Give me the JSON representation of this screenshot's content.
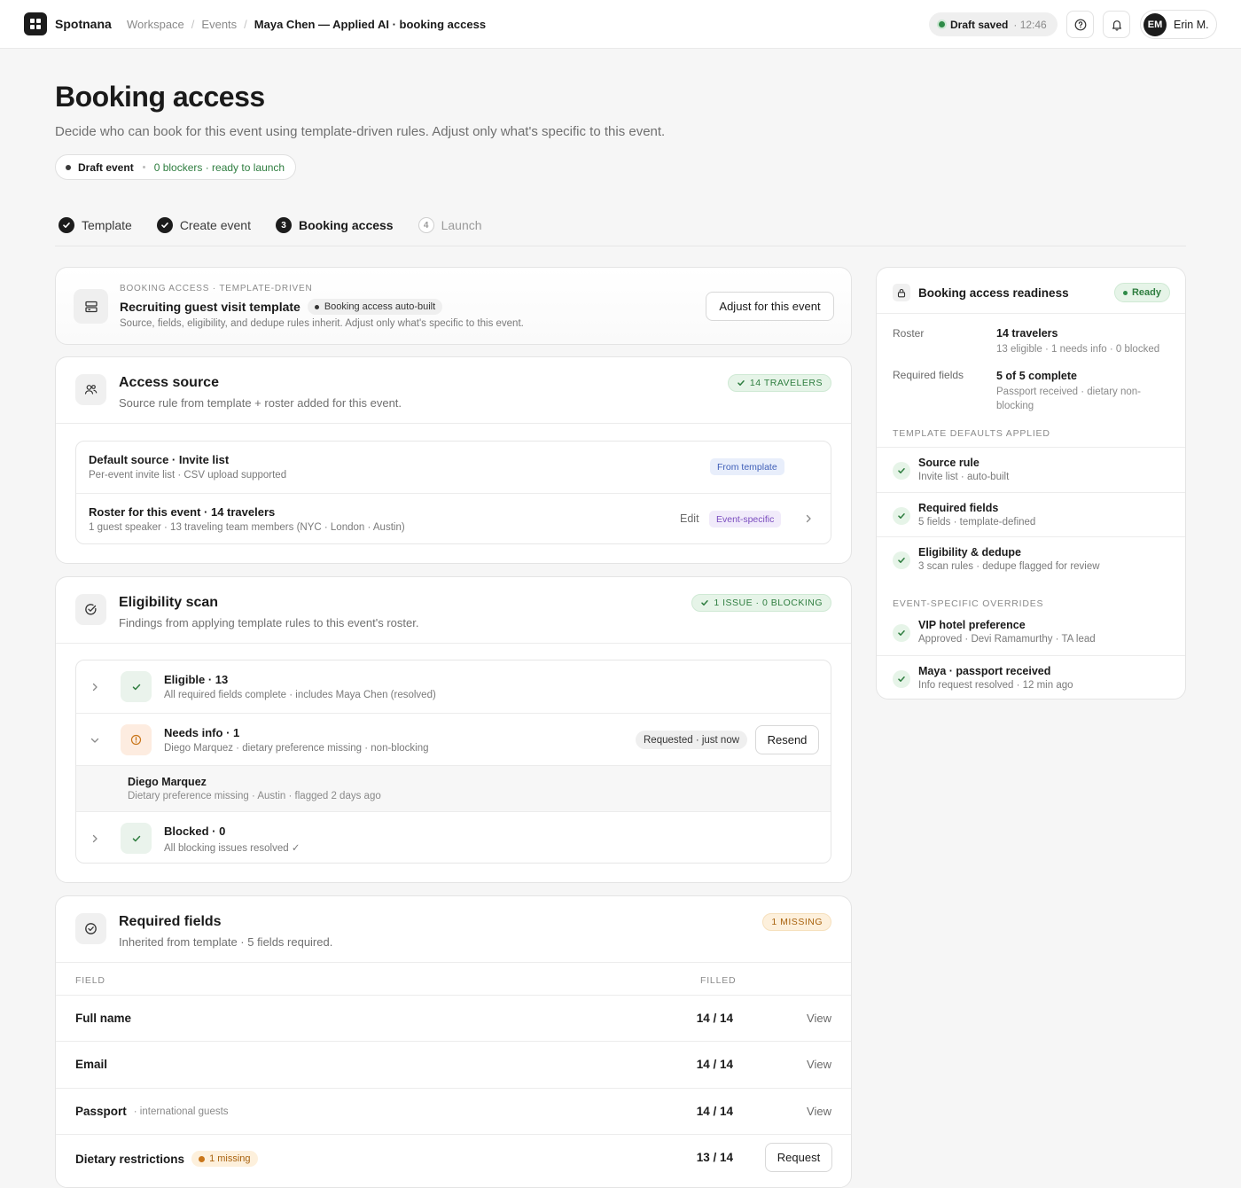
{
  "topbar": {
    "brand": "Spotnana",
    "crumbs": [
      "Workspace",
      "Events",
      "Maya Chen — Applied AI · booking access"
    ],
    "crumb_sep": "/",
    "saved_label": "Draft saved",
    "saved_time": "· 12:46",
    "user_initials": "EM",
    "user_name": "Erin M."
  },
  "page": {
    "title": "Booking access",
    "subtitle": "Decide who can book for this event using template-driven rules. Adjust only what's specific to this event.",
    "status_label": "Draft event",
    "status_note": "0 blockers · ready to launch"
  },
  "steps": [
    {
      "label": "Template",
      "state": "done"
    },
    {
      "label": "Create event",
      "state": "done"
    },
    {
      "label": "Booking access",
      "state": "current",
      "num": "3"
    },
    {
      "label": "Launch",
      "state": "todo",
      "num": "4"
    }
  ],
  "template_card": {
    "eyebrow": "BOOKING ACCESS · TEMPLATE-DRIVEN",
    "title": "Recruiting guest visit template",
    "chip": "Booking access auto-built",
    "desc": "Source, fields, eligibility, and dedupe rules inherit. Adjust only what's specific to this event.",
    "button": "Adjust for this event"
  },
  "access_source": {
    "title": "Access source",
    "subtitle": "Source rule from template + roster added for this event.",
    "badge": "14 TRAVELERS",
    "rows": [
      {
        "title": "Default source · Invite list",
        "sub": "Per-event invite list · CSV upload supported",
        "tag": "From template"
      },
      {
        "title": "Roster for this event · 14 travelers",
        "sub": "1 guest speaker · 13 traveling team members (NYC · London · Austin)",
        "edit": "Edit",
        "tag": "Event-specific"
      }
    ]
  },
  "eligibility": {
    "title": "Eligibility scan",
    "subtitle": "Findings from applying template rules to this event's roster.",
    "badge": "1 ISSUE · 0 BLOCKING",
    "rows": [
      {
        "title": "Eligible · 13",
        "sub": "All required fields complete · includes Maya Chen (resolved)"
      },
      {
        "title": "Needs info · 1",
        "sub": "Diego Marquez · dietary preference missing · non-blocking",
        "pill": "Requested · just now",
        "button": "Resend"
      },
      {
        "title": "Blocked · 0",
        "sub": "All blocking issues resolved ✓"
      }
    ],
    "detail": {
      "name": "Diego Marquez",
      "sub": "Dietary preference missing · Austin · flagged 2 days ago"
    }
  },
  "required_fields": {
    "title": "Required fields",
    "subtitle": "Inherited from template · 5 fields required.",
    "badge": "1 MISSING",
    "col_field": "FIELD",
    "col_filled": "FILLED",
    "rows": [
      {
        "name": "Full name",
        "note": "",
        "filled": "14 / 14",
        "action": "View"
      },
      {
        "name": "Email",
        "note": "",
        "filled": "14 / 14",
        "action": "View"
      },
      {
        "name": "Passport",
        "note": "· international guests",
        "filled": "14 / 14",
        "action": "View"
      },
      {
        "name": "Dietary restrictions",
        "missing": "1 missing",
        "filled": "13 / 14",
        "action": "Request"
      }
    ]
  },
  "readiness": {
    "title": "Booking access readiness",
    "status": "Ready",
    "roster_label": "Roster",
    "roster_value": "14 travelers",
    "roster_sub": "13 eligible · 1 needs info · 0 blocked",
    "fields_label": "Required fields",
    "fields_value": "5 of 5 complete",
    "fields_sub": "Passport received · dietary non-blocking",
    "defaults_heading": "TEMPLATE DEFAULTS APPLIED",
    "defaults": [
      {
        "title": "Source rule",
        "sub": "Invite list · auto-built"
      },
      {
        "title": "Required fields",
        "sub": "5 fields · template-defined"
      },
      {
        "title": "Eligibility & dedupe",
        "sub": "3 scan rules · dedupe flagged for review"
      }
    ],
    "overrides_heading": "EVENT-SPECIFIC OVERRIDES",
    "overrides": [
      {
        "title": "VIP hotel preference",
        "sub": "Approved · Devi Ramamurthy · TA lead"
      },
      {
        "title": "Maya · passport received",
        "sub": "Info request resolved · 12 min ago"
      }
    ]
  },
  "colors": {
    "accent_green": "#2e7d3f",
    "amber": "#a8620e",
    "blue_tag": "#3f5fb8",
    "purple_tag": "#7a4cbf"
  }
}
